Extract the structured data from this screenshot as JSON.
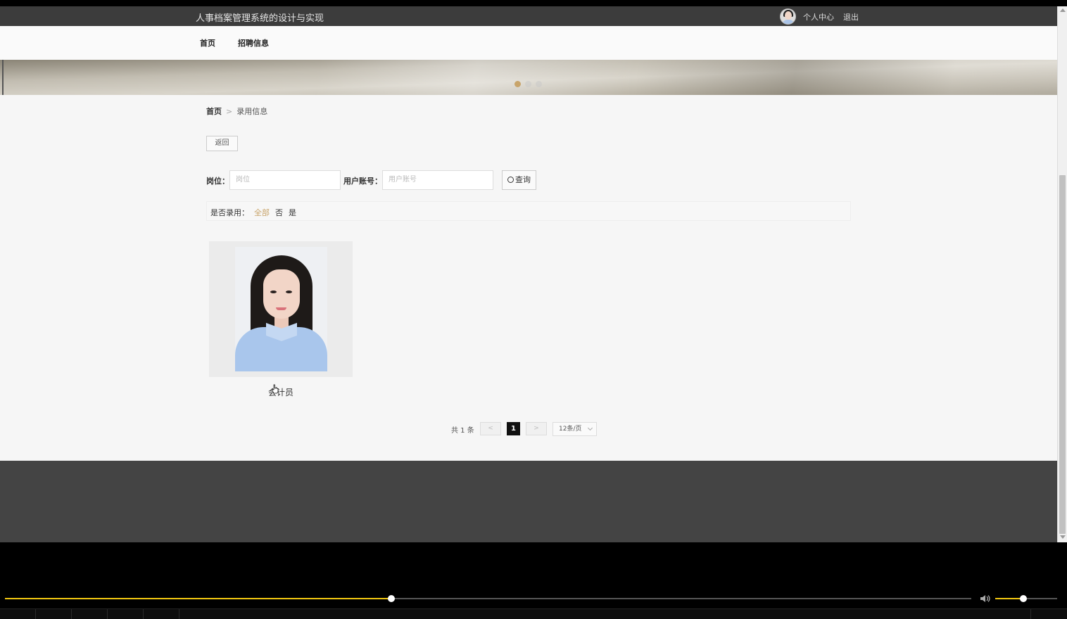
{
  "header": {
    "site_title": "人事档案管理系统的设计与实现",
    "personal_center": "个人中心",
    "logout": "退出"
  },
  "nav": {
    "items": [
      "首页",
      "招聘信息"
    ]
  },
  "banner": {
    "slide_count": 3,
    "active_slide": 1
  },
  "breadcrumb": {
    "home": "首页",
    "separator": ">",
    "current": "录用信息"
  },
  "back_button": "返回",
  "search": {
    "position_label": "岗位：",
    "position_placeholder": "岗位",
    "account_label": "用户账号：",
    "account_placeholder": "用户账号",
    "query_button": "查询"
  },
  "filter": {
    "label": "是否录用：",
    "options": [
      "全部",
      "否",
      "是"
    ],
    "selected": "全部"
  },
  "cards": [
    {
      "name": "会计员"
    }
  ],
  "pagination": {
    "total_text": "共 1 条",
    "prev": "<",
    "current_page": "1",
    "next": ">",
    "page_size": "12条/页"
  },
  "player": {
    "progress": 0.4,
    "volume": 0.45
  },
  "colors": {
    "header_bg": "#3c3c3c",
    "accent": "#c8a46a",
    "footer_bg": "#444444",
    "progress": "#f2c811"
  }
}
